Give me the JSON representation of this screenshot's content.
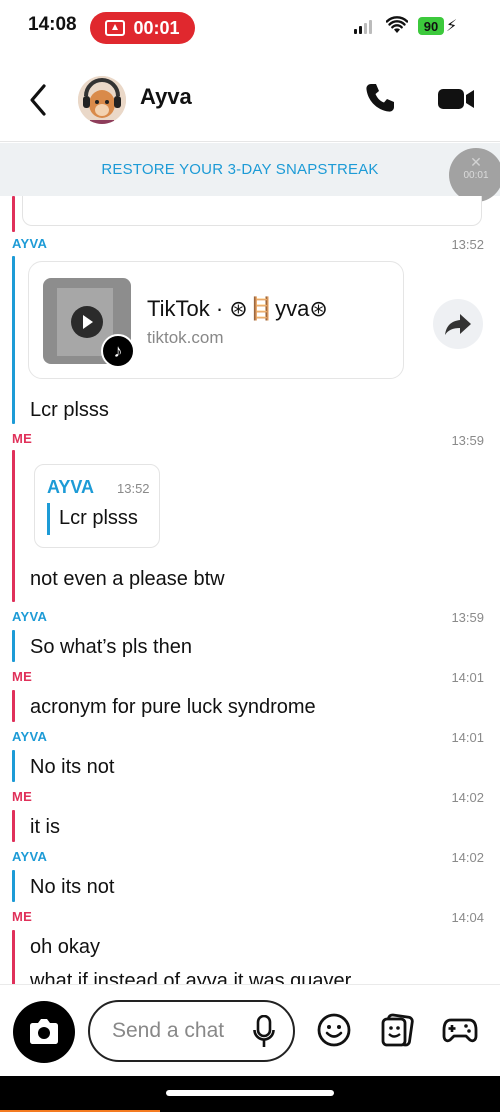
{
  "status_bar": {
    "time": "14:08",
    "recording": "00:01",
    "battery": "90"
  },
  "header": {
    "contact_name": "Ayva"
  },
  "banner": {
    "text": "RESTORE YOUR 3-DAY SNAPSTREAK",
    "timer": "00:01",
    "close": "✕"
  },
  "messages": [
    {
      "sender": "AYVA",
      "time": "13:52",
      "type": "link",
      "link_title": "TikTok · ⊛🪜yva⊛",
      "link_domain": "tiktok.com",
      "text": "Lcr plsss"
    },
    {
      "sender": "ME",
      "time": "13:59",
      "type": "reply",
      "quote_sender": "AYVA",
      "quote_time": "13:52",
      "quote_text": "Lcr plsss",
      "text": "not even a please btw"
    },
    {
      "sender": "AYVA",
      "time": "13:59",
      "text": "So what’s pls then"
    },
    {
      "sender": "ME",
      "time": "14:01",
      "text": "acronym for pure luck syndrome"
    },
    {
      "sender": "AYVA",
      "time": "14:01",
      "text": "No its not"
    },
    {
      "sender": "ME",
      "time": "14:02",
      "text": "it is"
    },
    {
      "sender": "AYVA",
      "time": "14:02",
      "text": "No its not"
    },
    {
      "sender": "ME",
      "time": "14:04",
      "text": "oh okay",
      "text2": "what if instead of ayva it was quaver"
    }
  ],
  "composer": {
    "placeholder": "Send a chat"
  },
  "colors": {
    "ayva": "#1d9bd6",
    "me": "#e0315a",
    "record": "#e0282e",
    "battery": "#3cc93c"
  },
  "icons": [
    "back-chevron-icon",
    "phone-icon",
    "video-camera-icon",
    "camera-icon",
    "microphone-icon",
    "smiley-icon",
    "stickers-icon",
    "gamepad-icon",
    "share-arrow-icon",
    "play-icon",
    "tiktok-icon"
  ]
}
